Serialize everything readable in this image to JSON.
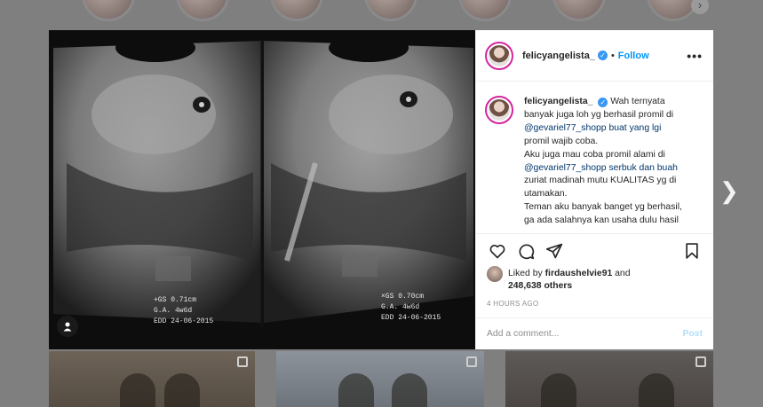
{
  "modal": {
    "post": {
      "username": "felicyangelista_",
      "follow_label": "Follow",
      "separator": "•",
      "more_label": "•••",
      "caption_lines": [
        "Wah ternyata",
        "banyak juga loh yg berhasil promil di",
        "@gevariel77_shopp buat yang lgi",
        "promil wajib coba.",
        "Aku juga mau coba promil alami di",
        "@gevariel77_shopp serbuk dan buah",
        "zuriat madinah mutu KUALITAS yg di",
        "utamakan.",
        "Teman aku banyak banget yg berhasil,",
        "ga ada salahnya kan usaha dulu hasil"
      ],
      "liked_by_prefix": "Liked by",
      "liked_by_user": "firdaushelvie91",
      "liked_by_and": "and",
      "likes_count": "248,638 others",
      "timestamp": "4 HOURS AGO",
      "comment_placeholder": "Add a comment...",
      "post_label": "Post"
    },
    "ultrasound_text": {
      "left": [
        "+GS  0.71cm",
        "G.A.   4w6d",
        "EDD  24-06-2015"
      ],
      "right": [
        "×GS  0.70cm",
        "G.A.   4w6d",
        "EDD  24-06-2015"
      ]
    }
  },
  "icons": [
    "heart-icon",
    "comment-icon",
    "share-icon",
    "bookmark-icon",
    "user-tag-icon",
    "chevron-right-icon",
    "verified-icon"
  ],
  "colors": {
    "accent": "#0095f6",
    "verified": "#3897f0",
    "story_ring": "#d6249f"
  }
}
